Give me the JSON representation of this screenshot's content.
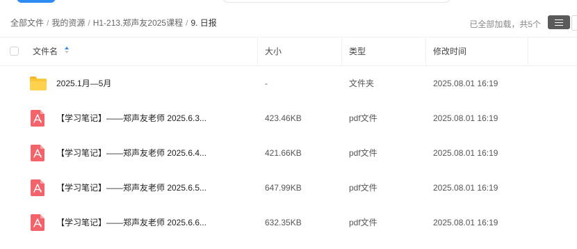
{
  "breadcrumb": {
    "items": [
      "全部文件",
      "我的资源",
      "H1-213.郑声友2025课程"
    ],
    "current": "9. 日报",
    "separator": "/"
  },
  "status": "已全部加载，共5个",
  "columns": {
    "name": "文件名",
    "size": "大小",
    "type": "类型",
    "modified": "修改时间"
  },
  "rows": [
    {
      "icon": "folder-icon",
      "name": "2025.1月—5月",
      "size": "-",
      "type": "文件夹",
      "modified": "2025.08.01 16:19"
    },
    {
      "icon": "pdf-icon",
      "name": "【学习笔记】——郑声友老师 2025.6.3...",
      "size": "423.46KB",
      "type": "pdf文件",
      "modified": "2025.08.01 16:19"
    },
    {
      "icon": "pdf-icon",
      "name": "【学习笔记】——郑声友老师 2025.6.4...",
      "size": "421.66KB",
      "type": "pdf文件",
      "modified": "2025.08.01 16:19"
    },
    {
      "icon": "pdf-icon",
      "name": "【学习笔记】——郑声友老师 2025.6.5...",
      "size": "647.99KB",
      "type": "pdf文件",
      "modified": "2025.08.01 16:19"
    },
    {
      "icon": "pdf-icon",
      "name": "【学习笔记】——郑声友老师 2025.6.6...",
      "size": "632.35KB",
      "type": "pdf文件",
      "modified": "2025.08.01 16:19"
    }
  ],
  "colors": {
    "accent": "#2f8cf5",
    "folder": "#fcc63b",
    "pdf": "#f2636b",
    "view_button": "#5a5a5a"
  }
}
